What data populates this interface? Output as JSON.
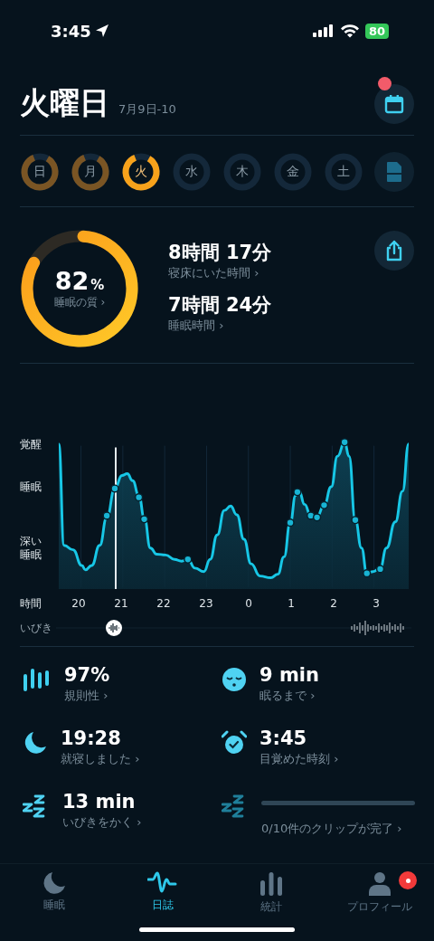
{
  "status_bar": {
    "time": "3:45",
    "battery": "80"
  },
  "header": {
    "title": "火曜日",
    "date": "7月9日-10",
    "calendar_badge": true
  },
  "days": [
    {
      "label": "日",
      "recorded": true,
      "selected": false
    },
    {
      "label": "月",
      "recorded": true,
      "selected": false
    },
    {
      "label": "火",
      "recorded": true,
      "selected": true
    },
    {
      "label": "水",
      "recorded": false,
      "selected": false
    },
    {
      "label": "木",
      "recorded": false,
      "selected": false
    },
    {
      "label": "金",
      "recorded": false,
      "selected": false
    },
    {
      "label": "土",
      "recorded": false,
      "selected": false
    }
  ],
  "summary": {
    "quality_value": "82",
    "quality_unit": "%",
    "quality_label": "睡眠の質 ›",
    "stats": [
      {
        "value": "8時間 17分",
        "label": "寝床にいた時間 ›"
      },
      {
        "value": "7時間 24分",
        "label": "睡眠時間 ›"
      }
    ]
  },
  "chart": {
    "y_labels": [
      "覚醒",
      "睡眠",
      "深い睡眠"
    ],
    "x_title": "時間",
    "x_labels": [
      "20",
      "21",
      "22",
      "23",
      "0",
      "1",
      "2",
      "3"
    ],
    "snore_label": "いびき"
  },
  "metrics": [
    {
      "kind": "regularity",
      "value": "97%",
      "label": "規則性 ›"
    },
    {
      "kind": "fall-asleep",
      "value": "9 min",
      "label": "眠るまで ›"
    },
    {
      "kind": "bedtime",
      "value": "19:28",
      "label": "就寝しました ›"
    },
    {
      "kind": "wake",
      "value": "3:45",
      "label": "目覚めた時刻 ›"
    },
    {
      "kind": "snore",
      "value": "13 min",
      "label": "いびきをかく ›"
    },
    {
      "kind": "clips",
      "level": 0,
      "label": "0/10件のクリップが完了 ›"
    }
  ],
  "tabs": [
    {
      "kind": "sleep",
      "label": "睡眠",
      "selected": false,
      "badge": false
    },
    {
      "kind": "journal",
      "label": "日誌",
      "selected": true,
      "badge": false
    },
    {
      "kind": "stats",
      "label": "統計",
      "selected": false,
      "badge": false
    },
    {
      "kind": "profile",
      "label": "プロフィール",
      "selected": false,
      "badge": true
    }
  ]
}
